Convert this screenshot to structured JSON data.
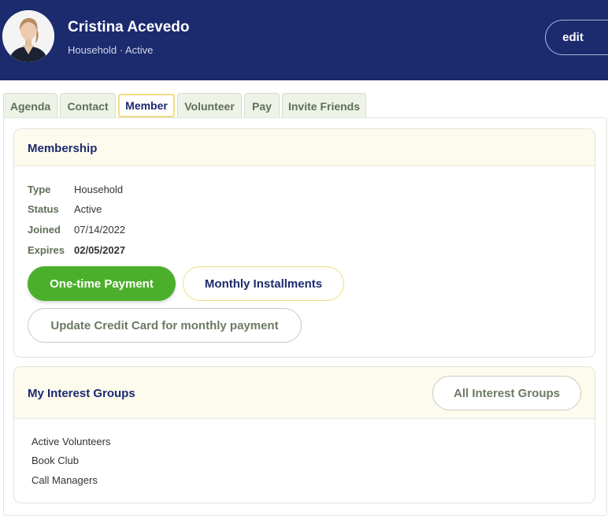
{
  "profile": {
    "name": "Cristina Acevedo",
    "subtitle": "Household · Active",
    "edit_label": "edit",
    "avatar_icon": "person-photo"
  },
  "tabs": [
    {
      "label": "Agenda"
    },
    {
      "label": "Contact"
    },
    {
      "label": "Member",
      "active": true
    },
    {
      "label": "Volunteer"
    },
    {
      "label": "Pay"
    },
    {
      "label": "Invite Friends"
    }
  ],
  "membership": {
    "title": "Membership",
    "rows": [
      {
        "label": "Type",
        "value": "Household"
      },
      {
        "label": "Status",
        "value": "Active"
      },
      {
        "label": "Joined",
        "value": "07/14/2022"
      },
      {
        "label": "Expires",
        "value": "02/05/2027"
      }
    ],
    "one_time_label": "One-time Payment",
    "monthly_label": "Monthly Installments",
    "update_card_label": "Update Credit Card for monthly payment"
  },
  "interest_groups": {
    "title": "My Interest Groups",
    "all_label": "All Interest Groups",
    "items": [
      "Active Volunteers",
      "Book Club",
      "Call Managers"
    ]
  },
  "colors": {
    "header": "#1c2a6e",
    "accent_green": "#4caf2c",
    "accent_yellow": "#f0dc86",
    "card_head": "#fdfbee"
  }
}
